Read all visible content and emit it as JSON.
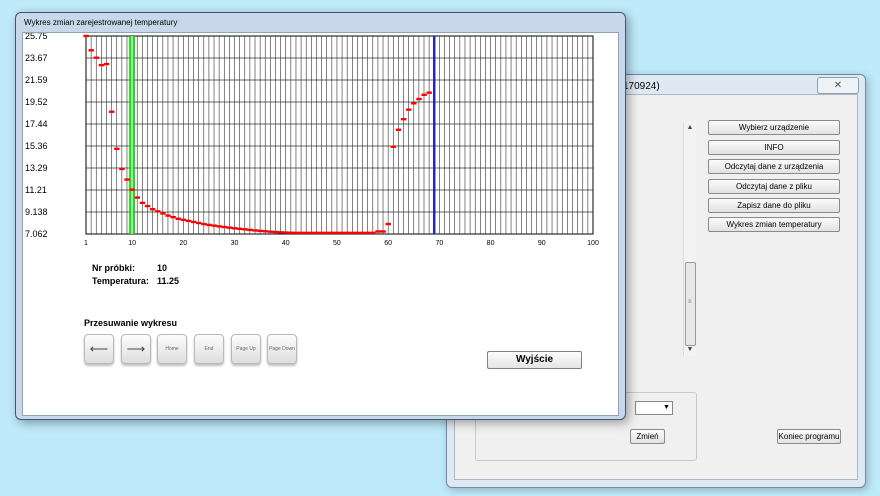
{
  "back_window": {
    "title_fragment": "170924)",
    "close_glyph": "✕",
    "buttons": {
      "select_device": "Wybierz urządzenie",
      "info": "INFO",
      "read_device": "Odczytaj dane z urządzenia",
      "read_file": "Odczytaj dane z pliku",
      "save_file": "Zapisz dane do pliku",
      "temp_chart": "Wykres zmian temperatury",
      "change": "Zmień",
      "exit_program": "Koniec programu"
    },
    "combo_value": ""
  },
  "front_window": {
    "title": "Wykres zmian zarejestrowanej temperatury",
    "sample_label": "Nr próbki:",
    "sample_value": "10",
    "temp_label": "Temperatura:",
    "temp_value": "11.25",
    "scroll_title": "Przesuwanie wykresu",
    "keys": {
      "left_icon": "left-arrow-icon",
      "right_icon": "right-arrow-icon",
      "home": "Home",
      "end": "End",
      "page_up": "Page Up",
      "page_down": "Page Down"
    },
    "exit_label": "Wyjście"
  },
  "chart_data": {
    "type": "scatter",
    "xlim": [
      1,
      100
    ],
    "ylim": [
      7.062,
      25.75
    ],
    "x_ticks": [
      1,
      10,
      20,
      30,
      40,
      50,
      60,
      70,
      80,
      90,
      100
    ],
    "y_tick_labels": [
      "25.75",
      "23.67",
      "21.59",
      "19.52",
      "17.44",
      "15.36",
      "13.29",
      "11.21",
      "9.138",
      "7.062"
    ],
    "grid": true,
    "colors": {
      "series": "#ff0000",
      "cursor": "#00d000",
      "marker": "#2020c0",
      "grid": "#000000"
    },
    "cursor_x": 10,
    "marker_x": 69,
    "series": [
      {
        "x": [
          1,
          2,
          3,
          4,
          5,
          6,
          7,
          8,
          9,
          10,
          11,
          12,
          13,
          14,
          15,
          16,
          17,
          18,
          19,
          20,
          21,
          22,
          23,
          24,
          25,
          26,
          27,
          28,
          29,
          30,
          31,
          32,
          33,
          34,
          35,
          36,
          37,
          38,
          39,
          40,
          41,
          42,
          43,
          44,
          45,
          46,
          47,
          48,
          49,
          50,
          51,
          52,
          53,
          54,
          55,
          56,
          57,
          58,
          59,
          60,
          61,
          62,
          63,
          64,
          65,
          66,
          67,
          68
        ],
        "y": [
          25.75,
          24.4,
          23.7,
          23.0,
          23.1,
          18.6,
          15.1,
          13.2,
          12.2,
          11.25,
          10.5,
          10.0,
          9.7,
          9.4,
          9.2,
          9.0,
          8.8,
          8.65,
          8.5,
          8.4,
          8.3,
          8.2,
          8.1,
          8.0,
          7.92,
          7.85,
          7.78,
          7.72,
          7.66,
          7.6,
          7.55,
          7.5,
          7.45,
          7.4,
          7.36,
          7.32,
          7.28,
          7.25,
          7.22,
          7.2,
          7.18,
          7.17,
          7.17,
          7.17,
          7.17,
          7.17,
          7.17,
          7.17,
          7.17,
          7.17,
          7.17,
          7.17,
          7.17,
          7.17,
          7.17,
          7.17,
          7.17,
          7.3,
          7.3,
          8.0,
          15.3,
          16.9,
          17.9,
          18.8,
          19.4,
          19.8,
          20.2,
          20.4
        ]
      }
    ]
  }
}
